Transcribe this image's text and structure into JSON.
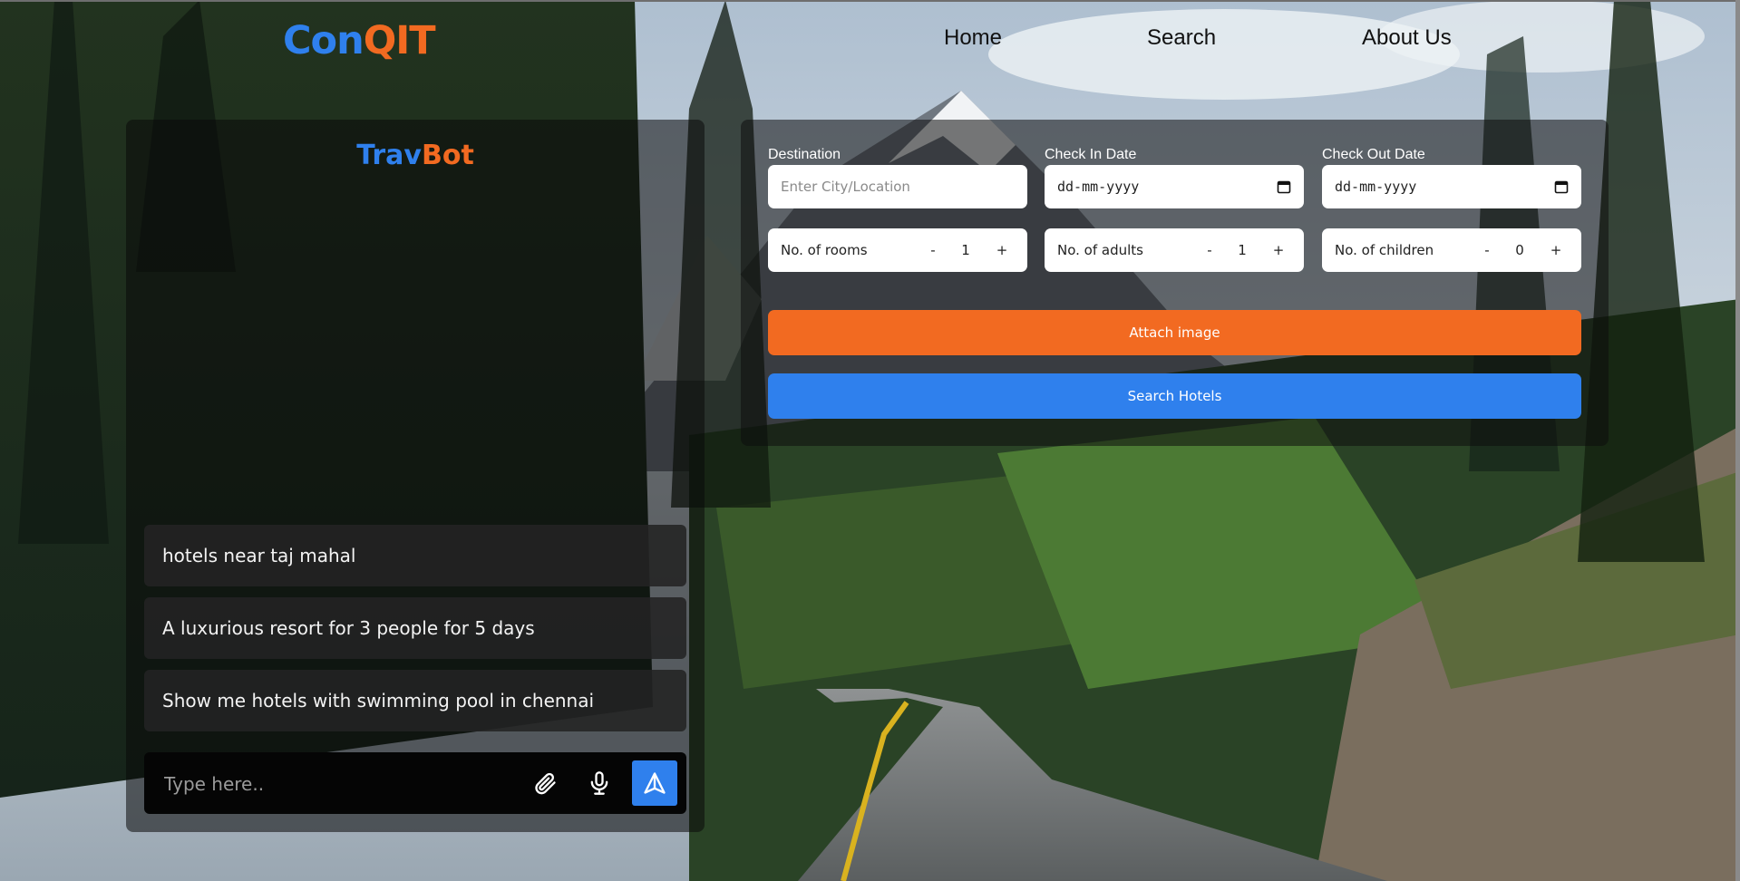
{
  "brand": {
    "logo_part1": "Con",
    "logo_part2": "QIT"
  },
  "nav": {
    "items": [
      {
        "label": "Home"
      },
      {
        "label": "Search"
      },
      {
        "label": "About Us"
      }
    ]
  },
  "chat": {
    "title_part1": "Trav",
    "title_part2": "Bot",
    "suggestions": [
      {
        "text": "hotels near taj mahal"
      },
      {
        "text": "A luxurious resort for 3 people for 5 days"
      },
      {
        "text": "Show me hotels with swimming pool in chennai"
      }
    ],
    "input_placeholder": "Type here..",
    "icons": {
      "attach": "paperclip-icon",
      "mic": "microphone-icon",
      "send": "send-icon"
    }
  },
  "search": {
    "destination": {
      "label": "Destination",
      "placeholder": "Enter City/Location",
      "value": ""
    },
    "check_in": {
      "label": "Check In Date",
      "value": "dd-mm-yyyy"
    },
    "check_out": {
      "label": "Check Out Date",
      "value": "dd-mm-yyyy"
    },
    "rooms": {
      "label": "No. of rooms",
      "value": "1"
    },
    "adults": {
      "label": "No. of adults",
      "value": "1"
    },
    "children": {
      "label": "No. of children",
      "value": "0"
    },
    "stepper_minus": "-",
    "stepper_plus": "+",
    "attach_button": "Attach image",
    "search_button": "Search Hotels"
  },
  "colors": {
    "brand_blue": "#2f80ed",
    "brand_orange": "#f26a21"
  }
}
